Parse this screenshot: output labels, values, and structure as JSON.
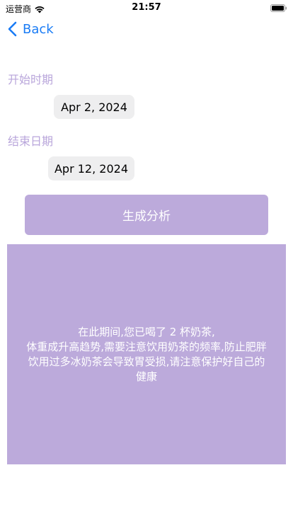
{
  "status_bar": {
    "carrier": "运营商",
    "time": "21:57"
  },
  "nav": {
    "back_label": "Back"
  },
  "form": {
    "start_label": "开始时期",
    "start_date": "Apr 2, 2024",
    "end_label": "结束日期",
    "end_date": "Apr 12, 2024",
    "generate_label": "生成分析"
  },
  "analysis": {
    "lines": [
      "在此期间,您已喝了 2 杯奶茶,",
      "体重成升高趋势,需要注意饮用奶茶的频率,防止肥胖",
      "饮用过多冰奶茶会导致胃受损,请注意保护好自己的",
      "健康"
    ]
  },
  "colors": {
    "accent_purple": "#bcaadb",
    "label_purple": "#b9a6db",
    "link_blue": "#1a7cf5"
  }
}
